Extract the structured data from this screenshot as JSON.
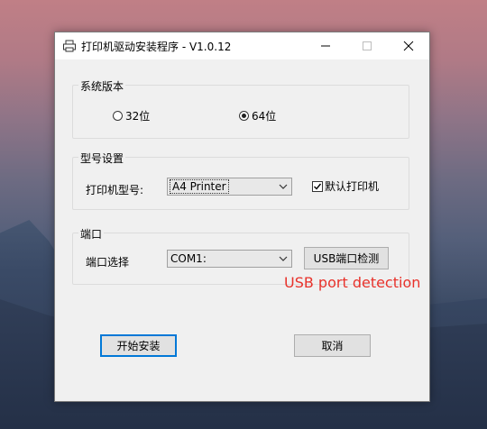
{
  "window": {
    "title": "打印机驱动安装程序 - V1.0.12",
    "controls": {
      "minimize": "minimize",
      "maximize": "maximize",
      "close": "close"
    }
  },
  "system_version": {
    "group_title": "系统版本",
    "options": [
      {
        "label": "32位",
        "selected": false
      },
      {
        "label": "64位",
        "selected": true
      }
    ]
  },
  "model": {
    "group_title": "型号设置",
    "label": "打印机型号:",
    "selected_value": "A4 Printer",
    "default_printer_label": "默认打印机",
    "default_printer_checked": true
  },
  "port": {
    "group_title": "端口",
    "label": "端口选择",
    "selected_value": "COM1:",
    "detect_button": "USB端口检测"
  },
  "annotation": "USB port  detection",
  "buttons": {
    "install": "开始安装",
    "cancel": "取消"
  },
  "colors": {
    "annotation": "#e8322b",
    "focus_border": "#0078d7"
  }
}
